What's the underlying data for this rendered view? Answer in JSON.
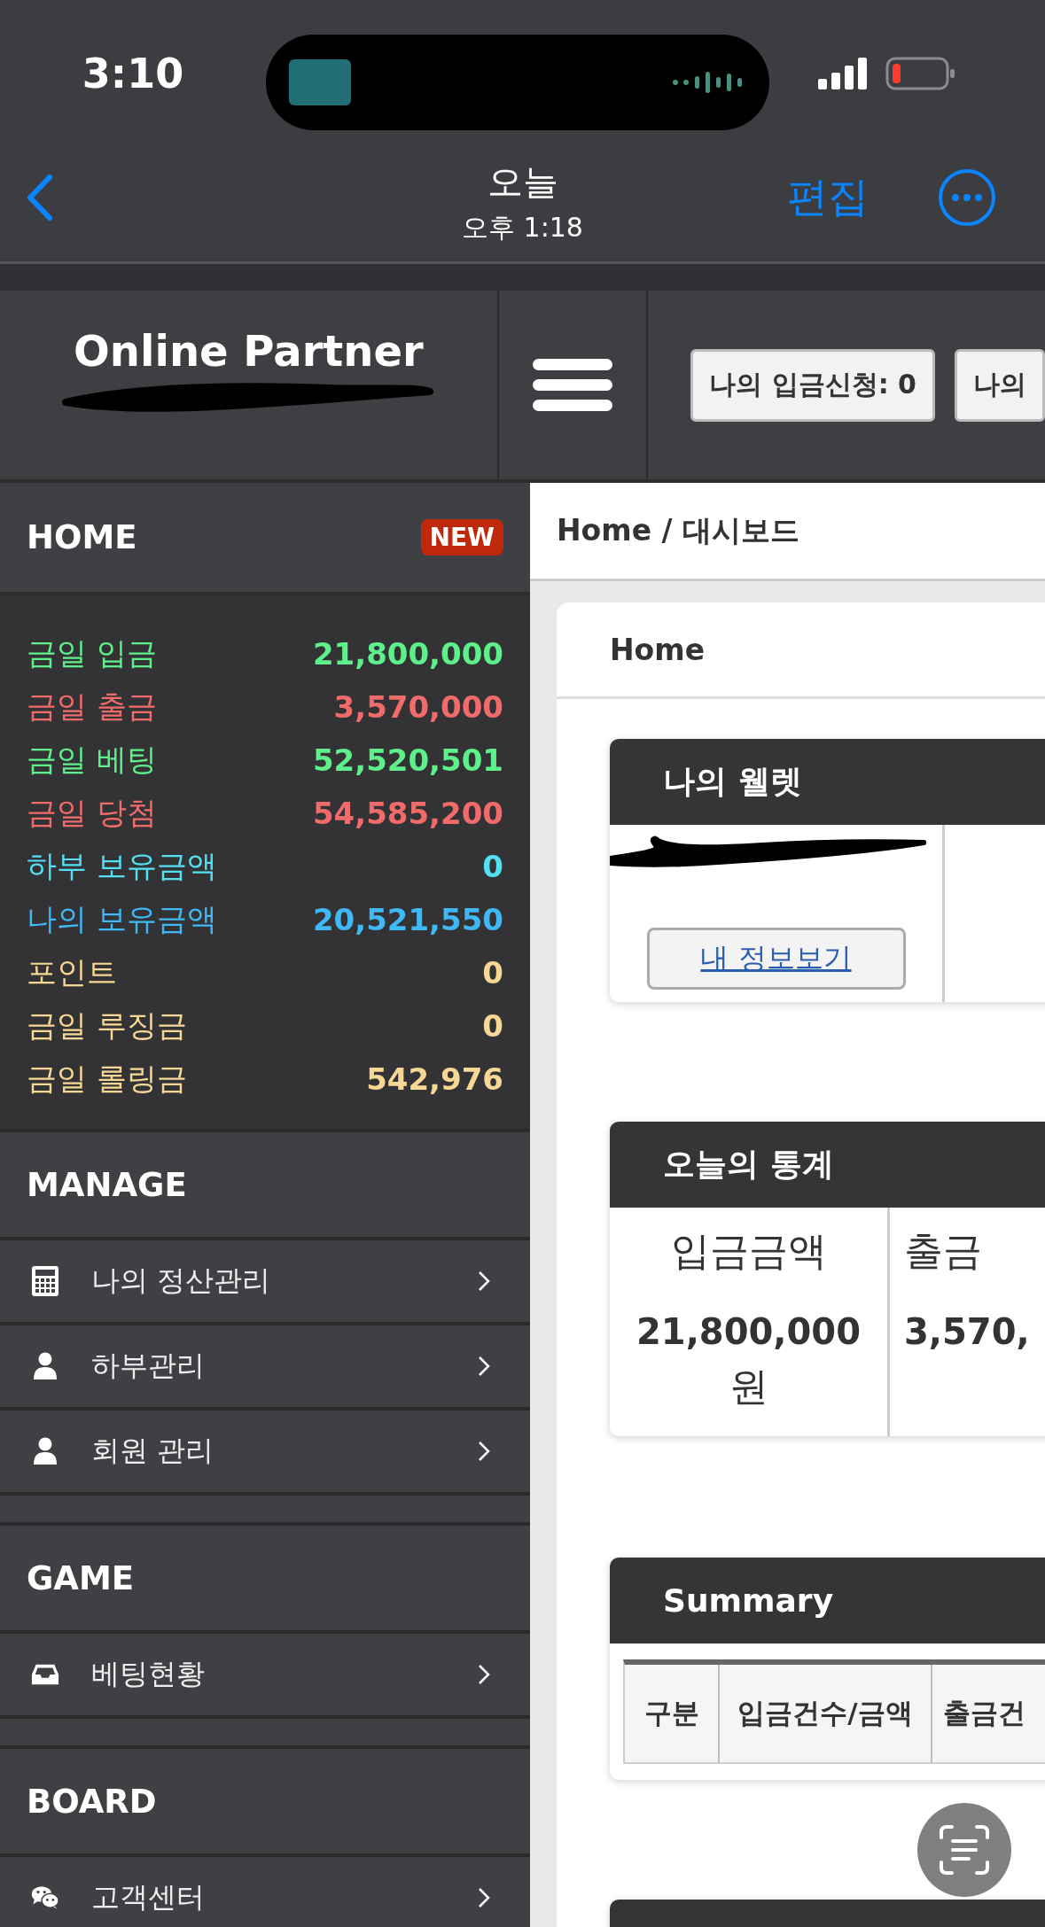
{
  "status_bar": {
    "time": "3:10"
  },
  "nav": {
    "title": "오늘",
    "subtitle": "오후 1:18",
    "edit": "편집"
  },
  "site": {
    "brand": "Online Partner",
    "header_buttons": [
      "나의 입금신청: 0",
      "나의"
    ]
  },
  "sidebar": {
    "home": {
      "title": "HOME",
      "badge": "NEW"
    },
    "stats": [
      {
        "label": "금일 입금",
        "value": "21,800,000",
        "color": "#5ef08a"
      },
      {
        "label": "금일 출금",
        "value": "3,570,000",
        "color": "#f26b6b"
      },
      {
        "label": "금일 베팅",
        "value": "52,520,501",
        "color": "#5ef08a"
      },
      {
        "label": "금일 당첨",
        "value": "54,585,200",
        "color": "#f26b6b"
      },
      {
        "label": "하부 보유금액",
        "value": "0",
        "color": "#52e0f2"
      },
      {
        "label": "나의 보유금액",
        "value": "20,521,550",
        "color": "#3fb8f5"
      },
      {
        "label": "포인트",
        "value": "0",
        "color": "#f7d794"
      },
      {
        "label": "금일 루징금",
        "value": "0",
        "color": "#f7d794"
      },
      {
        "label": "금일 롤링금",
        "value": "542,976",
        "color": "#f7d794"
      }
    ],
    "sections": [
      {
        "title": "MANAGE",
        "items": [
          {
            "label": "나의 정산관리",
            "kind": "calculator"
          },
          {
            "label": "하부관리",
            "kind": "user"
          },
          {
            "label": "회원 관리",
            "kind": "user"
          }
        ]
      },
      {
        "title": "GAME",
        "items": [
          {
            "label": "베팅현황",
            "kind": "inbox"
          }
        ]
      },
      {
        "title": "BOARD",
        "items": [
          {
            "label": "고객센터",
            "kind": "chat"
          }
        ]
      }
    ]
  },
  "main": {
    "breadcrumb": "Home / 대시보드",
    "card_title": "Home",
    "wallet": {
      "title": "나의 웰렛",
      "button": "내 정보보기"
    },
    "today": {
      "title": "오늘의 통계",
      "columns": [
        {
          "label": "입금금액",
          "value": "21,800,000",
          "unit": "원"
        },
        {
          "label": "출금",
          "value": "3,570,"
        }
      ]
    },
    "summary": {
      "title": "Summary",
      "columns": [
        "구분",
        "입금건수/금액",
        "출금건"
      ]
    }
  }
}
